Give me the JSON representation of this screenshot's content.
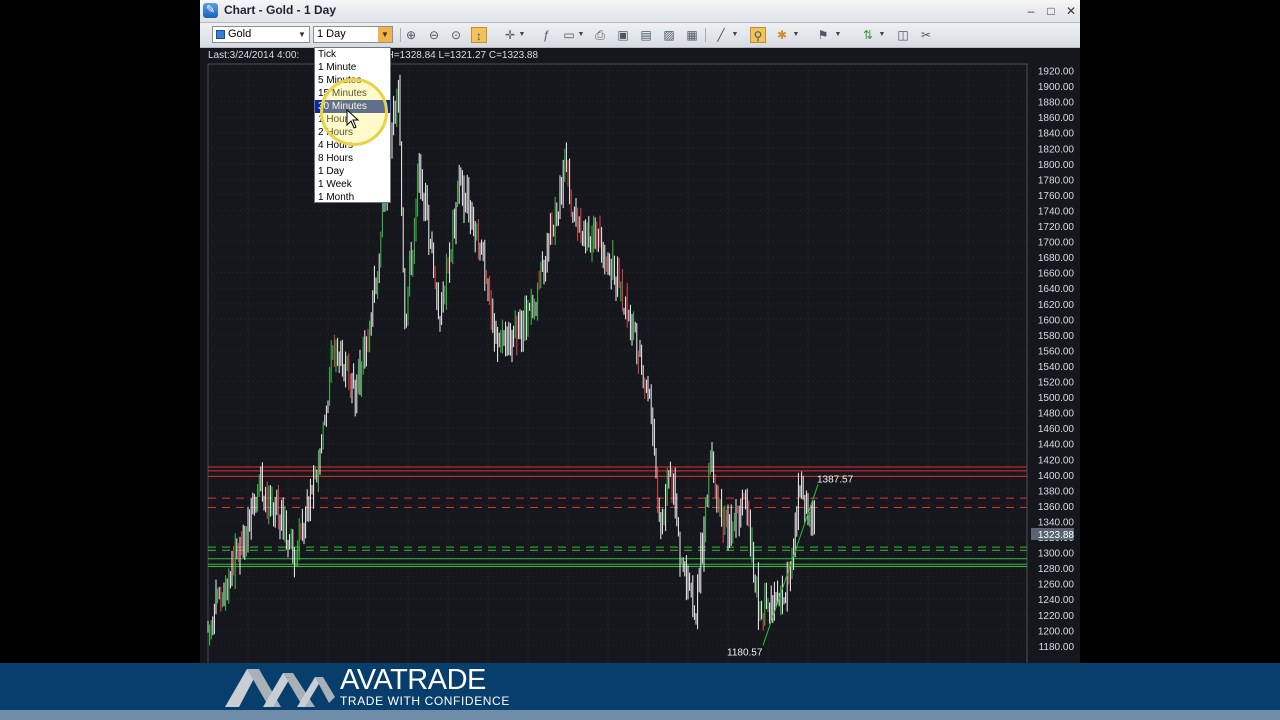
{
  "window": {
    "title": "Chart - Gold - 1 Day"
  },
  "toolbar": {
    "symbol": "Gold",
    "timeframe": "1 Day"
  },
  "chart": {
    "info_prefix": "Last:3/24/2014 4:00:",
    "info_suffix": "6 H=1328.84 L=1321.27 C=1323.88",
    "y_ticks": [
      "1920.00",
      "1900.00",
      "1880.00",
      "1860.00",
      "1840.00",
      "1820.00",
      "1800.00",
      "1780.00",
      "1760.00",
      "1740.00",
      "1720.00",
      "1700.00",
      "1680.00",
      "1660.00",
      "1640.00",
      "1620.00",
      "1600.00",
      "1580.00",
      "1560.00",
      "1540.00",
      "1520.00",
      "1500.00",
      "1480.00",
      "1460.00",
      "1440.00",
      "1420.00",
      "1400.00",
      "1380.00",
      "1360.00",
      "1340.00",
      "1320.00",
      "1300.00",
      "1280.00",
      "1260.00",
      "1240.00",
      "1220.00",
      "1200.00",
      "1180.00"
    ],
    "current_price": "1323.88",
    "high_label": "1387.57",
    "low_label": "1180.57"
  },
  "timeframe_menu": {
    "items": [
      "Tick",
      "1 Minute",
      "5 Minutes",
      "15 Minutes",
      "30 Minutes",
      "1 Hour",
      "2 Hours",
      "4 Hours",
      "8 Hours",
      "1 Day",
      "1 Week",
      "1 Month"
    ],
    "selected": "30 Minutes"
  },
  "brand": {
    "name": "AVATRADE",
    "tagline": "TRADE WITH CONFIDENCE"
  }
}
